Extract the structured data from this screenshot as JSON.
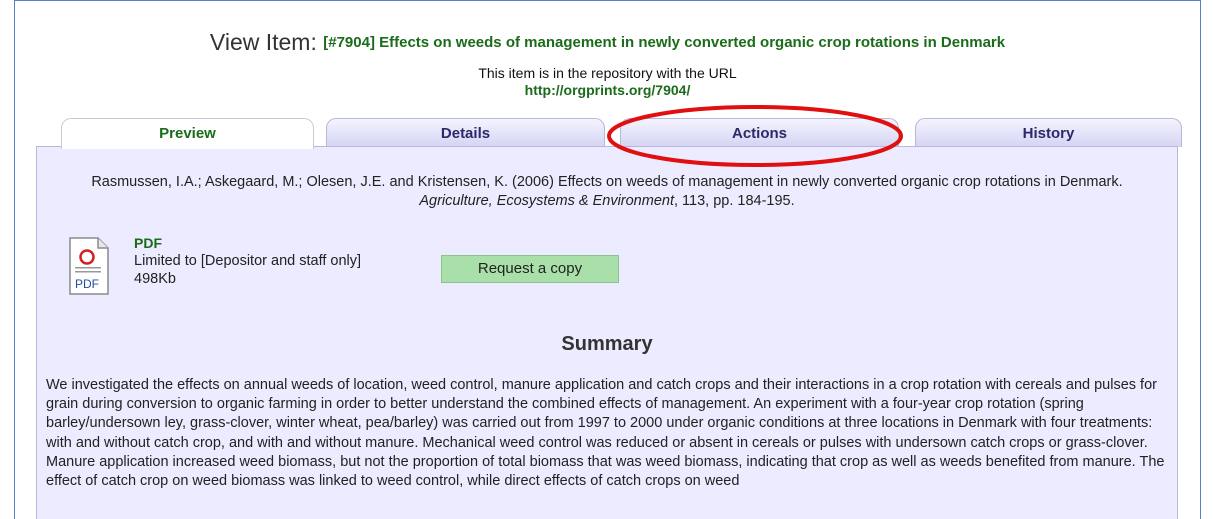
{
  "header": {
    "view_label": "View Item: ",
    "item_title": "[#7904] Effects on weeds of management in newly converted organic crop rotations in Denmark",
    "url_note": "This item is in the repository with the URL",
    "url": "http://orgprints.org/7904/"
  },
  "tabs": [
    {
      "label": "Preview",
      "active": true
    },
    {
      "label": "Details",
      "active": false
    },
    {
      "label": "Actions",
      "active": false
    },
    {
      "label": "History",
      "active": false
    }
  ],
  "citation": {
    "authors_year_title": "Rasmussen, I.A.; Askegaard, M.; Olesen, J.E. and Kristensen, K. (2006) Effects on weeds of management in newly converted organic crop rotations in Denmark.",
    "journal": "Agriculture, Ecosystems & Environment",
    "tail": ", 113, pp. 184-195."
  },
  "document": {
    "type": "PDF",
    "icon_label": "PDF",
    "access": "Limited to [Depositor and staff only]",
    "size": "498Kb",
    "request_button": "Request a copy"
  },
  "summary": {
    "heading": "Summary",
    "text": "We investigated the effects on annual weeds of location, weed control, manure application and catch crops and their interactions in a crop rotation with cereals and pulses for grain during conversion to organic farming in order to better understand the combined effects of management. An experiment with a four-year crop rotation (spring barley/undersown ley, grass-clover, winter wheat, pea/barley) was carried out from 1997 to 2000 under organic conditions at three locations in Denmark with four treatments: with and without catch crop, and with and without manure. Mechanical weed control was reduced or absent in cereals or pulses with undersown catch crops or grass-clover. Manure application increased weed biomass, but not the proportion of total biomass that was weed biomass, indicating that crop as well as weeds benefited from manure. The effect of catch crop on weed biomass was linked to weed control, while direct effects of catch crops on weed"
  },
  "colors": {
    "accent_green": "#1a6b1a",
    "panel_bg": "#ecebff",
    "highlight_red": "#e01010"
  }
}
